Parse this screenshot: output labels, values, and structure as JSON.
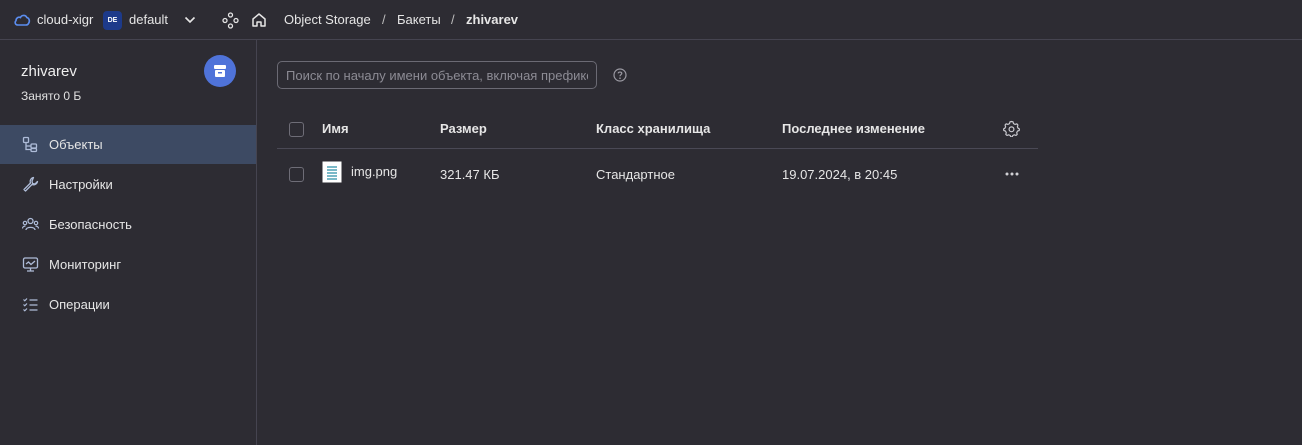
{
  "topbar": {
    "cloud_name": "cloud-xigr",
    "folder_badge": "DE",
    "folder_name": "default",
    "breadcrumbs": [
      "Object Storage",
      "Бакеты",
      "zhivarev"
    ],
    "separator": "/"
  },
  "sidebar": {
    "bucket_name": "zhivarev",
    "used_space": "Занято 0 Б",
    "items": [
      {
        "label": "Объекты",
        "icon": "objects-icon",
        "active": true
      },
      {
        "label": "Настройки",
        "icon": "wrench-icon",
        "active": false
      },
      {
        "label": "Безопасность",
        "icon": "users-icon",
        "active": false
      },
      {
        "label": "Мониторинг",
        "icon": "monitor-icon",
        "active": false
      },
      {
        "label": "Операции",
        "icon": "list-icon",
        "active": false
      }
    ]
  },
  "search": {
    "placeholder": "Поиск по началу имени объекта, включая префикс",
    "value": ""
  },
  "table": {
    "headers": [
      "Имя",
      "Размер",
      "Класс хранилища",
      "Последнее изменение"
    ],
    "rows": [
      {
        "name": "img.png",
        "size": "321.47 КБ",
        "storage_class": "Стандартное",
        "modified": "19.07.2024, в 20:45"
      }
    ]
  },
  "colors": {
    "background": "#2d2c33",
    "active_nav": "#3d4a63",
    "accent": "#4f73d9"
  }
}
